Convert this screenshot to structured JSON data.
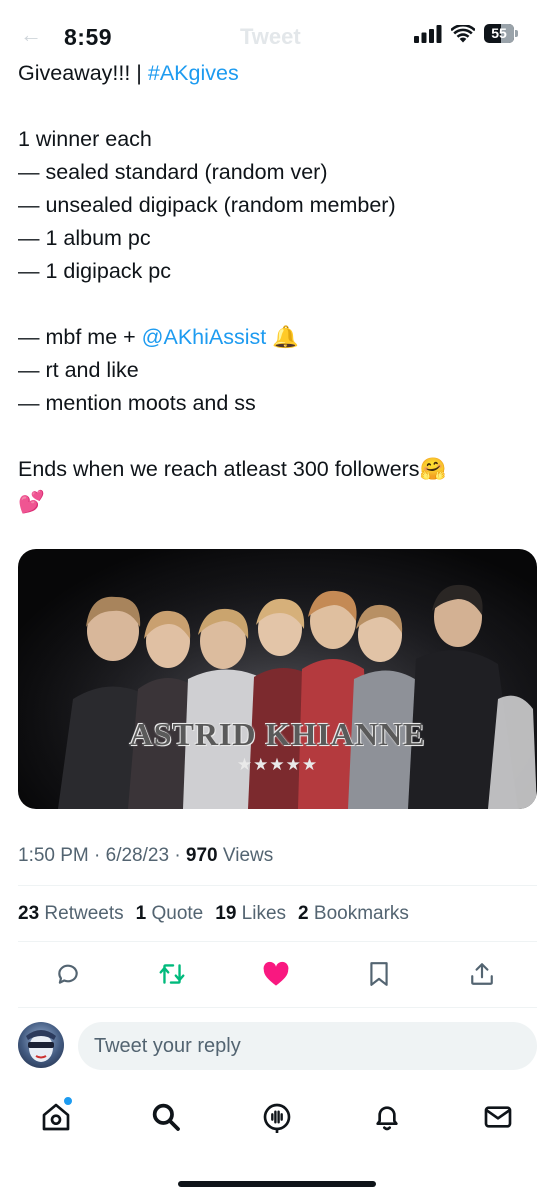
{
  "status_bar": {
    "time": "8:59",
    "battery": "55",
    "battery_level": 0.55,
    "behind_title": "Tweet",
    "behind_nav": "←"
  },
  "tweet": {
    "lines": [
      [
        {
          "t": "Giveaway!!! | "
        },
        {
          "t": "#AKgives",
          "link": true
        }
      ],
      [
        {
          "t": ""
        }
      ],
      [
        {
          "t": "1 winner each"
        }
      ],
      [
        {
          "t": "— sealed standard (random ver)"
        }
      ],
      [
        {
          "t": "— unsealed digipack (random member)"
        }
      ],
      [
        {
          "t": "— 1 album pc"
        }
      ],
      [
        {
          "t": "— 1 digipack pc"
        }
      ],
      [
        {
          "t": ""
        }
      ],
      [
        {
          "t": "— mbf me + "
        },
        {
          "t": "@AKhiAssist",
          "link": true
        },
        {
          "t": " 🔔"
        }
      ],
      [
        {
          "t": "— rt and like"
        }
      ],
      [
        {
          "t": "— mention moots and ss"
        }
      ],
      [
        {
          "t": ""
        }
      ],
      [
        {
          "t": "Ends when we reach atleast 300 followers🤗"
        }
      ],
      [
        {
          "t": "💕"
        }
      ]
    ],
    "media": {
      "watermark": "ASTRID KHIANNE",
      "stars": "★★★★★"
    },
    "timestamp": "1:50 PM · 6/28/23 · ",
    "views_count": "970",
    "views_label": " Views",
    "stats": [
      {
        "count": "23",
        "label": "Retweets"
      },
      {
        "count": "1",
        "label": "Quote"
      },
      {
        "count": "19",
        "label": "Likes"
      },
      {
        "count": "2",
        "label": "Bookmarks"
      }
    ]
  },
  "actions": {
    "reply_icon": "reply-icon",
    "retweet_icon": "retweet-icon",
    "like_icon": "heart-filled-icon",
    "bookmark_icon": "bookmark-icon",
    "share_icon": "share-icon"
  },
  "reply": {
    "placeholder": "Tweet your reply"
  },
  "tabbar": [
    "home-icon",
    "search-icon",
    "spaces-icon",
    "notifications-icon",
    "messages-icon"
  ],
  "colors": {
    "link": "#1d9bf0",
    "retweet": "#00ba7c",
    "like": "#f91880",
    "muted": "#536471",
    "text": "#0f1419"
  }
}
